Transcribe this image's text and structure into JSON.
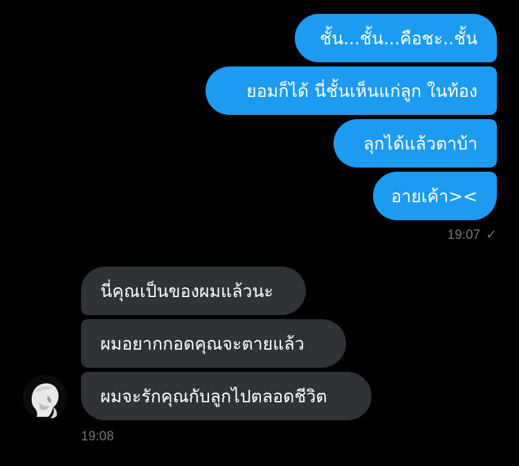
{
  "outgoing": {
    "messages": [
      "ชั้น...ชั้น...คือชะ..ชั้น",
      "ยอมก็ได้ นี่ชั้นเห็นแก่ลูก ในท้อง",
      "ลุกได้แล้วตาบ้า",
      "อายเค้า><"
    ],
    "time": "19:07",
    "read_mark": "✓"
  },
  "incoming": {
    "messages": [
      "นี่คุณเป็นของผมแล้วนะ",
      "ผมอยากกอดคุณจะตายแล้ว",
      "ผมจะรักคุณกับลูกไปตลอดชีวิต"
    ],
    "time": "19:08",
    "avatar_icon": "user-avatar-bust-icon"
  },
  "colors": {
    "background": "#000000",
    "outgoing_bubble": "#1d9bf0",
    "incoming_bubble": "#2f3336",
    "timestamp": "#71767b"
  }
}
